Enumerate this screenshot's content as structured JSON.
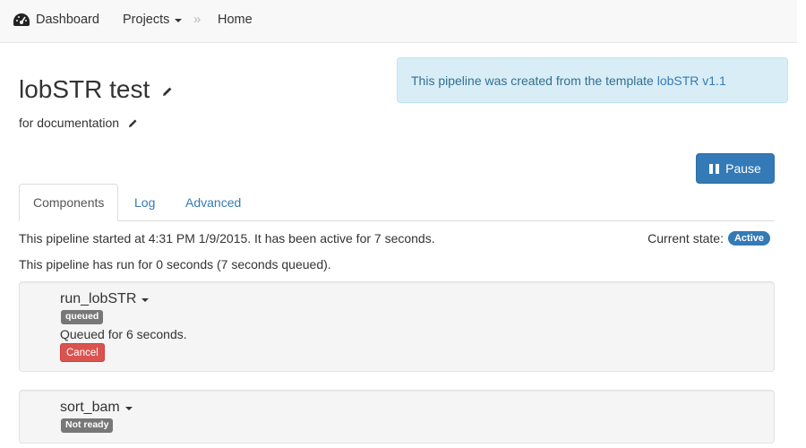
{
  "navbar": {
    "dashboard_label": "Dashboard",
    "projects_label": "Projects",
    "separator": "»",
    "home_label": "Home"
  },
  "pipeline": {
    "title": "lobSTR test",
    "description": "for documentation"
  },
  "alert": {
    "prefix": "This pipeline was created from the template ",
    "link_text": "lobSTR v1.1"
  },
  "pause_label": "Pause",
  "tabs": [
    {
      "label": "Components",
      "active": true
    },
    {
      "label": "Log",
      "active": false
    },
    {
      "label": "Advanced",
      "active": false
    }
  ],
  "status": {
    "started_text": "This pipeline started at 4:31 PM 1/9/2015. It has been active for 7 seconds.",
    "current_state_label": "Current state:",
    "current_state": "Active",
    "runtime_text": "This pipeline has run for 0 seconds (7 seconds queued)."
  },
  "components": [
    {
      "name": "run_lobSTR",
      "badge": "queued",
      "status_text": "Queued for 6 seconds.",
      "action_label": "Cancel"
    },
    {
      "name": "sort_bam",
      "badge": "Not ready"
    }
  ],
  "colors": {
    "primary": "#337ab7",
    "danger": "#d9534f",
    "info_bg": "#d9edf7",
    "info_text": "#31708f",
    "badge_gray": "#777777"
  }
}
